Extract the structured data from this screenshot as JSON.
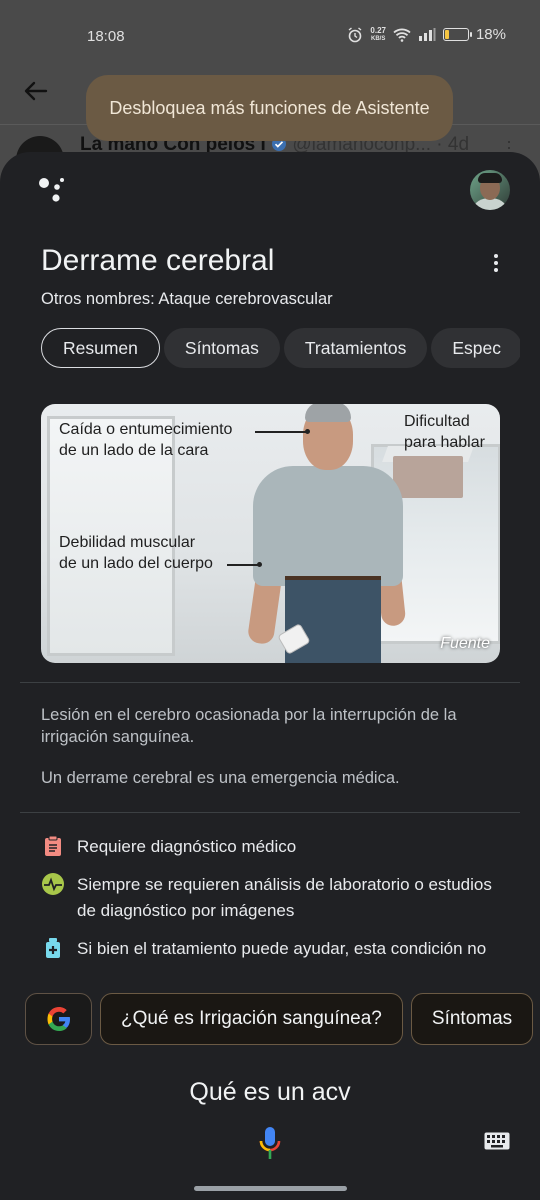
{
  "status_bar": {
    "time": "18:08",
    "net_speed_value": "0.27",
    "net_speed_unit": "KB/S",
    "battery": "18%",
    "battery_level": 0.18
  },
  "background_app": {
    "tweet_author": "La mano Con pelos I",
    "tweet_handle": "@lamanoconp...",
    "tweet_age": "· 4d"
  },
  "toast": "Desbloquea más funciones de Asistente",
  "card": {
    "title": "Derrame cerebral",
    "alt_names": "Otros nombres: Ataque cerebrovascular",
    "tabs": [
      "Resumen",
      "Síntomas",
      "Tratamientos",
      "Espec"
    ],
    "image": {
      "label_face": "Caída o entumecimiento\nde un lado de la cara",
      "label_speech": "Dificultad\npara hablar",
      "label_weakness": "Debilidad muscular\nde un lado del cuerpo",
      "source": "Fuente"
    },
    "description_1": "Lesión en el cerebro ocasionada por la interrupción de la irrigación sanguínea.",
    "description_2": "Un derrame cerebral es una emergencia médica.",
    "facts": [
      {
        "icon": "clipboard-icon",
        "text": "Requiere diagnóstico médico",
        "color": "#f28b82"
      },
      {
        "icon": "pulse-icon",
        "text": "Siempre se requieren análisis de laboratorio o estudios de diagnóstico por imágenes",
        "color": "#a8c74a"
      },
      {
        "icon": "medicine-bottle-icon",
        "text": "Si bien el tratamiento puede ayudar, esta condición no tiene cura",
        "color": "#78d9ec"
      }
    ]
  },
  "suggestions": [
    "¿Qué es Irrigación sanguínea?",
    "Síntomas"
  ],
  "query": "Qué es un acv",
  "colors": {
    "sheet_bg": "#202124",
    "toast_bg": "#6b5a44",
    "chip_bg": "#303134"
  }
}
